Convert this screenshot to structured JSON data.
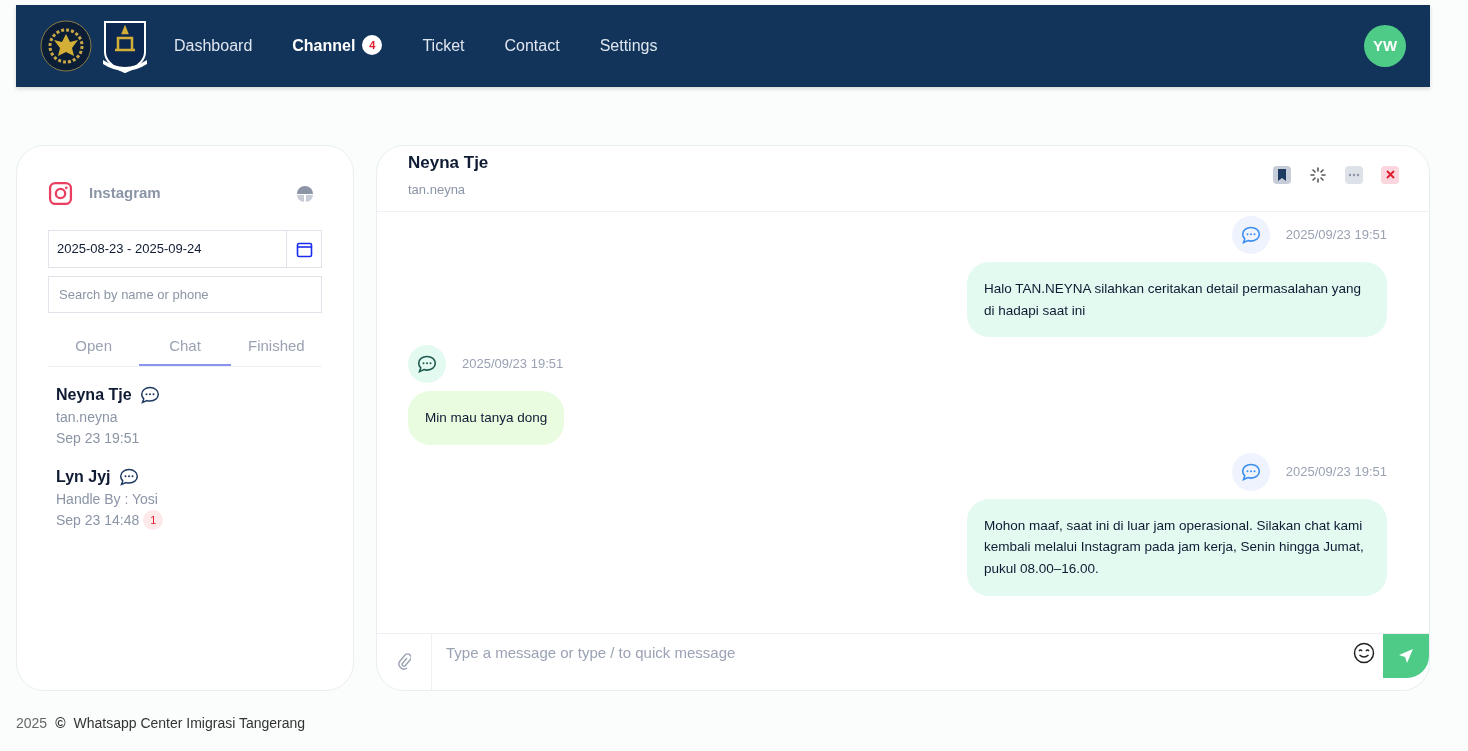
{
  "navbar": {
    "items": [
      {
        "label": "Dashboard",
        "selected": false
      },
      {
        "label": "Channel",
        "selected": true,
        "badge": "4"
      },
      {
        "label": "Ticket",
        "selected": false
      },
      {
        "label": "Contact",
        "selected": false
      },
      {
        "label": "Settings",
        "selected": false
      }
    ],
    "avatar": "YW"
  },
  "sidebar": {
    "channel": "Instagram",
    "date_range": "2025-08-23 - 2025-09-24",
    "search": {
      "placeholder": "Search by name or phone"
    },
    "tabs": [
      {
        "label": "Open",
        "selected": false
      },
      {
        "label": "Chat",
        "selected": true
      },
      {
        "label": "Finished",
        "selected": false
      }
    ],
    "contacts": [
      {
        "name": "Neyna Tje",
        "subtitle": "tan.neyna",
        "time": "Sep 23 19:51"
      },
      {
        "name": "Lyn Jyj",
        "subtitle": "Handle By : Yosi",
        "time": "Sep 23 14:48",
        "unread": "1"
      }
    ]
  },
  "chat": {
    "name": "Neyna Tje",
    "handle": "tan.neyna",
    "messages": [
      {
        "kind": "outgoing",
        "time": "2025/09/23 19:51",
        "text": "Halo TAN.NEYNA silahkan ceritakan detail permasalahan yang di hadapi saat ini"
      },
      {
        "kind": "incoming",
        "time": "2025/09/23 19:51",
        "text": "Min mau tanya dong"
      },
      {
        "kind": "outgoing",
        "time": "2025/09/23 19:51",
        "text": "Mohon maaf, saat ini di luar jam operasional. Silakan chat kami kembali melalui Instagram pada jam kerja, Senin hingga Jumat, pukul 08.00–16.00."
      }
    ],
    "composer": {
      "placeholder": "Type a message or type / to quick message"
    }
  },
  "footer": {
    "year": "2025",
    "symbol": "©",
    "text": "Whatsapp Center Imigrasi Tangerang"
  }
}
